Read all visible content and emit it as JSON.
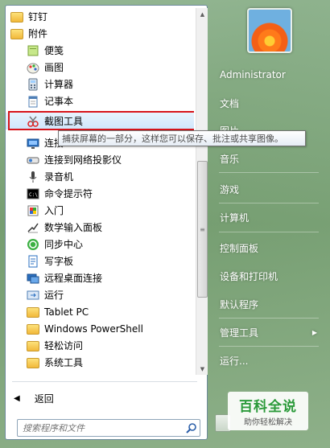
{
  "programs": {
    "items": [
      {
        "label": "钉钉",
        "icon": "folder-icon",
        "kind": "folder"
      },
      {
        "label": "附件",
        "icon": "folder-open-icon",
        "kind": "folder"
      },
      {
        "label": "便笺",
        "icon": "sticky-notes-icon",
        "kind": "sub"
      },
      {
        "label": "画图",
        "icon": "paint-icon",
        "kind": "sub"
      },
      {
        "label": "计算器",
        "icon": "calculator-icon",
        "kind": "sub"
      },
      {
        "label": "记事本",
        "icon": "notepad-icon",
        "kind": "sub"
      },
      {
        "label": "截图工具",
        "icon": "snipping-tool-icon",
        "kind": "sub"
      },
      {
        "label": "连接",
        "icon": "projector-icon",
        "kind": "sub"
      },
      {
        "label": "连接到网络投影仪",
        "icon": "network-projector-icon",
        "kind": "sub"
      },
      {
        "label": "录音机",
        "icon": "microphone-icon",
        "kind": "sub"
      },
      {
        "label": "命令提示符",
        "icon": "cmd-icon",
        "kind": "sub"
      },
      {
        "label": "入门",
        "icon": "getting-started-icon",
        "kind": "sub"
      },
      {
        "label": "数学输入面板",
        "icon": "math-input-icon",
        "kind": "sub"
      },
      {
        "label": "同步中心",
        "icon": "sync-center-icon",
        "kind": "sub"
      },
      {
        "label": "写字板",
        "icon": "wordpad-icon",
        "kind": "sub"
      },
      {
        "label": "远程桌面连接",
        "icon": "remote-desktop-icon",
        "kind": "sub"
      },
      {
        "label": "运行",
        "icon": "run-icon",
        "kind": "sub"
      },
      {
        "label": "Tablet PC",
        "icon": "folder-icon",
        "kind": "subfolder"
      },
      {
        "label": "Windows PowerShell",
        "icon": "folder-icon",
        "kind": "subfolder"
      },
      {
        "label": "轻松访问",
        "icon": "folder-icon",
        "kind": "subfolder"
      },
      {
        "label": "系统工具",
        "icon": "folder-icon",
        "kind": "subfolder"
      }
    ],
    "selected_index": 6
  },
  "tooltip": "捕获屏幕的一部分，这样您可以保存、批注或共享图像。",
  "back_label": "返回",
  "search": {
    "placeholder": "搜索程序和文件"
  },
  "right_menu": [
    {
      "label": "Administrator"
    },
    {
      "label": "文档"
    },
    {
      "label": "图片"
    },
    {
      "label": "音乐"
    },
    {
      "label": "游戏"
    },
    {
      "label": "计算机"
    },
    {
      "label": "控制面板"
    },
    {
      "label": "设备和打印机"
    },
    {
      "label": "默认程序"
    },
    {
      "label": "管理工具",
      "has_submenu": true
    },
    {
      "label": "运行..."
    }
  ],
  "watermark": {
    "title": "百科全说",
    "subtitle": "助你轻松解决"
  },
  "colors": {
    "highlight_border": "#d7141a",
    "watermark_green": "#2b9a3a"
  }
}
